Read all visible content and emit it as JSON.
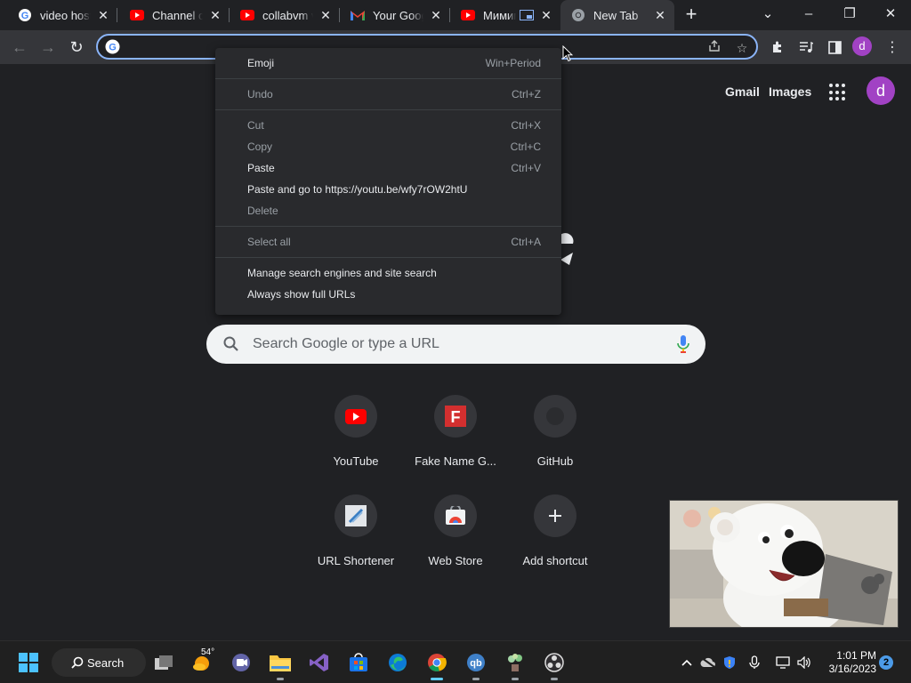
{
  "browser": {
    "tabs": [
      {
        "title": "video hosting",
        "icon": "google-icon"
      },
      {
        "title": "Channel content",
        "icon": "youtube-icon"
      },
      {
        "title": "collabvm vi",
        "icon": "youtube-icon"
      },
      {
        "title": "Your Google",
        "icon": "gmail-icon"
      },
      {
        "title": "Мимими",
        "icon": "youtube-icon"
      },
      {
        "title": "New Tab",
        "icon": "chrome-icon",
        "active": true
      }
    ],
    "new_tab_symbol": "+",
    "window_controls": {
      "tab_search": "⌄",
      "minimize": "–",
      "restore": "❐",
      "close": "✕"
    }
  },
  "toolbar": {
    "back": "←",
    "forward": "→",
    "reload": "↻",
    "address_value": "",
    "profile_letter": "d"
  },
  "ntp": {
    "gmail": "Gmail",
    "images": "Images",
    "avatar_letter": "d",
    "search_placeholder": "Search Google or type a URL",
    "shortcuts": [
      {
        "label": "YouTube",
        "icon": "youtube-icon"
      },
      {
        "label": "Fake Name G...",
        "icon": "fakename-icon"
      },
      {
        "label": "GitHub",
        "icon": "github-icon"
      },
      {
        "label": "URL Shortener",
        "icon": "url-shortener-icon"
      },
      {
        "label": "Web Store",
        "icon": "web-store-icon"
      },
      {
        "label": "Add shortcut",
        "icon": "plus-icon"
      }
    ]
  },
  "context_menu": {
    "items": [
      {
        "label": "Emoji",
        "shortcut": "Win+Period",
        "enabled": true
      },
      {
        "label": "Undo",
        "shortcut": "Ctrl+Z",
        "enabled": false
      },
      {
        "label": "Cut",
        "shortcut": "Ctrl+X",
        "enabled": false
      },
      {
        "label": "Copy",
        "shortcut": "Ctrl+C",
        "enabled": false
      },
      {
        "label": "Paste",
        "shortcut": "Ctrl+V",
        "enabled": true
      },
      {
        "label": "Paste and go to https://youtu.be/wfy7rOW2htU",
        "shortcut": "",
        "enabled": true
      },
      {
        "label": "Delete",
        "shortcut": "",
        "enabled": false
      },
      {
        "label": "Select all",
        "shortcut": "Ctrl+A",
        "enabled": false
      },
      {
        "label": "Manage search engines and site search",
        "shortcut": "",
        "enabled": true
      },
      {
        "label": "Always show full URLs",
        "shortcut": "",
        "enabled": true
      }
    ]
  },
  "taskbar": {
    "search_label": "Search",
    "weather_temp": "54°",
    "time": "1:01 PM",
    "date": "3/16/2023",
    "notification_count": "2"
  },
  "colors": {
    "accent": "#8ab4f8",
    "profile": "#a142c4",
    "page_bg": "#202124",
    "toolbar_bg": "#35363a"
  }
}
